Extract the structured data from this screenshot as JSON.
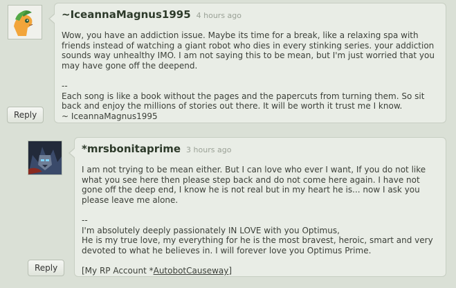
{
  "comments": [
    {
      "username": "~IceannaMagnus1995",
      "time": "4 hours ago",
      "reply_label": "Reply",
      "paragraphs": [
        "Wow, you have an addiction issue. Maybe its time for a break, like a relaxing spa with friends instead of watching a giant robot who dies in every stinking series. your addiction sounds way unhealthy IMO. I am not saying this to be mean, but I'm just worried that you may have gone off the deepend.",
        "--\nEach song is like a book without the pages and the papercuts from turning them. So sit back and enjoy the millions of stories out there. It will be worth it trust me I know.\n~ IceannaMagnus1995"
      ]
    },
    {
      "username": "*mrsbonitaprime",
      "time": "3 hours ago",
      "reply_label": "Reply",
      "paragraphs": [
        "I am not trying to be mean either. But I can love who ever I want, If you do not like what you see here then please step back and do not come here again. I have not gone off the deep end, I know he is not real but in my heart he is... now I ask you please leave me alone.",
        "--\nI'm absolutely deeply passionately IN LOVE with you Optimus,\nHe is my true love, my everything for he is the most bravest, heroic, smart and very devoted to what he believes in. I will forever love you Optimus Prime."
      ],
      "rp_prefix": "[My RP Account *",
      "rp_link": "AutobotCauseway",
      "rp_suffix": "]"
    }
  ]
}
